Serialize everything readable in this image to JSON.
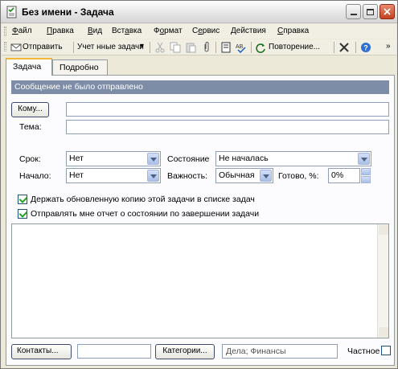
{
  "window": {
    "title": "Без имени - Задача"
  },
  "menu": [
    {
      "prefix": "",
      "u": "Ф",
      "rest": "айл"
    },
    {
      "prefix": "",
      "u": "П",
      "rest": "равка"
    },
    {
      "prefix": "",
      "u": "В",
      "rest": "ид"
    },
    {
      "prefix": "Вст",
      "u": "а",
      "rest": "вка"
    },
    {
      "prefix": "Ф",
      "u": "о",
      "rest": "рмат"
    },
    {
      "prefix": "С",
      "u": "е",
      "rest": "рвис"
    },
    {
      "prefix": "",
      "u": "Д",
      "rest": "ействия"
    },
    {
      "prefix": "",
      "u": "С",
      "rest": "правка"
    }
  ],
  "toolbar": {
    "send": "Отправить",
    "manage": "Учет нные задачи",
    "recurrence": "Повторение...",
    "icons": [
      "save-icon",
      "cut-icon",
      "copy-icon",
      "paste-icon",
      "attach-icon",
      "address-book-icon",
      "spell-check-icon",
      "delete-icon",
      "help-icon"
    ]
  },
  "tabs": [
    "Задача",
    "Подробно"
  ],
  "info": "Сообщение не было отправлено",
  "form": {
    "to_button": "Кому...",
    "to_value": "",
    "subject_label": "Тема:",
    "subject_value": "",
    "due_label": "Срок:",
    "due_value": "Нет",
    "start_label": "Начало:",
    "start_value": "Нет",
    "status_label": "Состояние",
    "status_value": "Не началась",
    "priority_label": "Важность:",
    "priority_value": "Обычная",
    "complete_label": "Готово, %:",
    "complete_value": "0%",
    "keep_copy": "Держать обновленную копию этой задачи в списке задач",
    "send_report": "Отправлять мне отчет о состоянии по завершении задачи",
    "keep_copy_checked": true,
    "send_report_checked": true
  },
  "footer": {
    "contacts_button": "Контакты...",
    "contacts_value": "",
    "categories_button": "Категории...",
    "categories_value": "Дела; Финансы",
    "private_label": "Частное",
    "private_checked": false
  }
}
